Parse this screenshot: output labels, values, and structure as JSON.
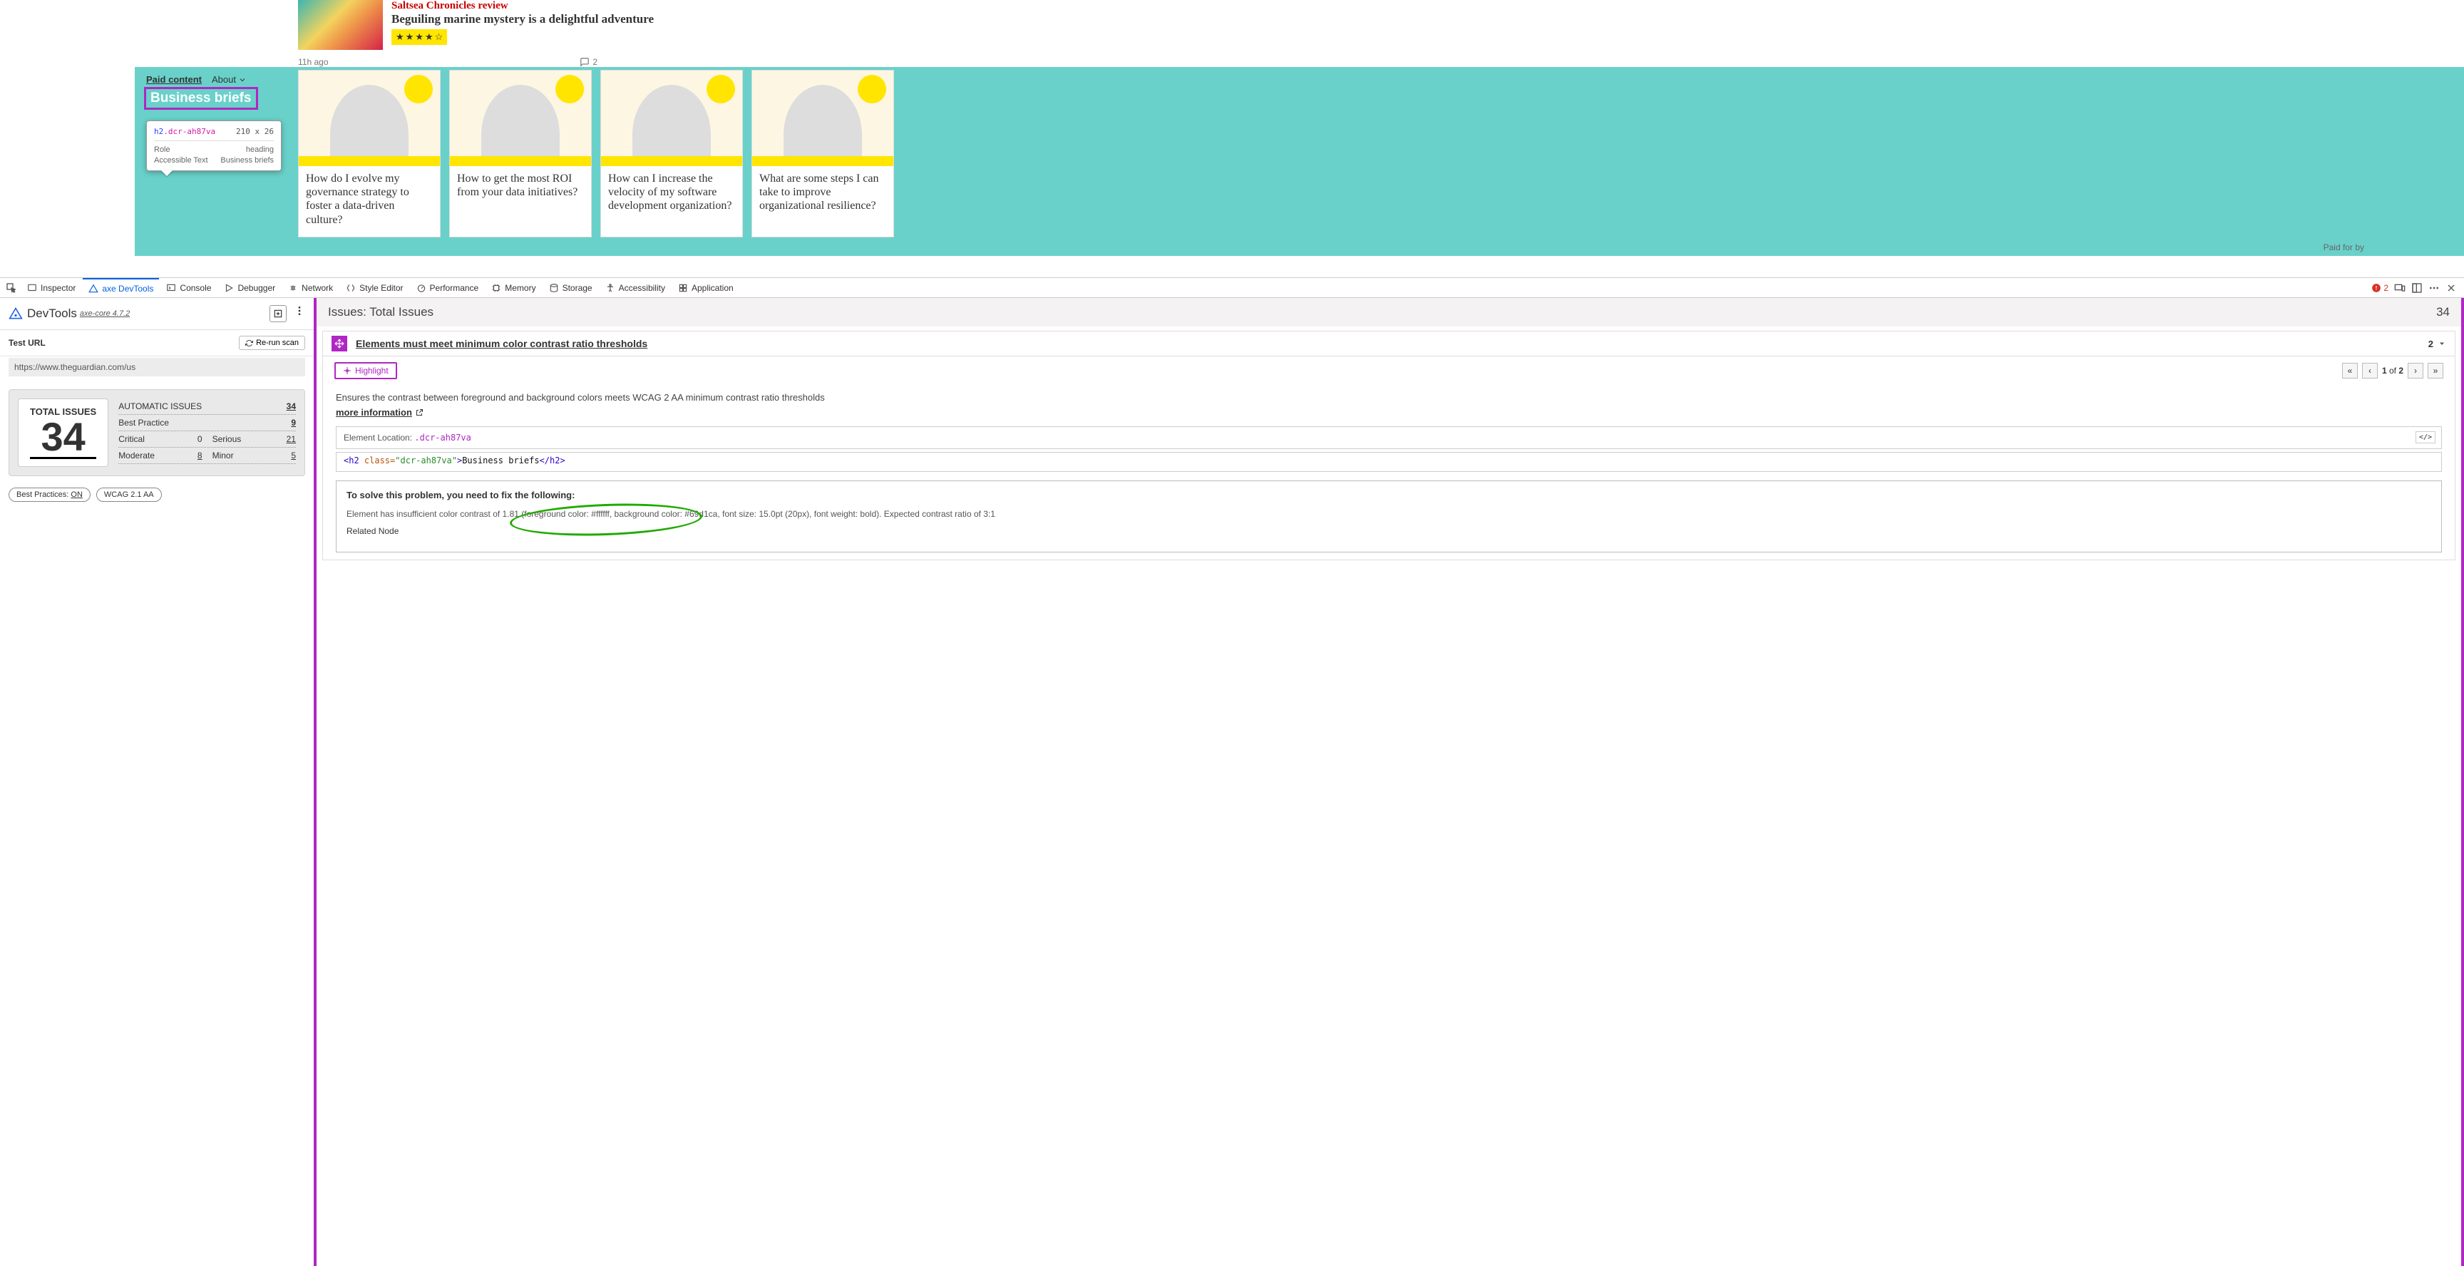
{
  "article": {
    "kicker": "Saltsea Chronicles review",
    "headline": "Beguiling marine mystery is a delightful adventure",
    "time": "11h ago",
    "comments": "2",
    "star_full": "★",
    "star_empty": "☆"
  },
  "paid": {
    "label": "Paid content",
    "about": "About",
    "heading": "Business briefs",
    "paid_for": "Paid for by",
    "cards": [
      {
        "title": "How do I evolve my governance strategy to foster a data-driven culture?"
      },
      {
        "title": "How to get the most ROI from your data initiatives?"
      },
      {
        "title": "How can I increase the velocity of my software development organization?"
      },
      {
        "title": "What are some steps I can take to improve organizational resilience?"
      }
    ]
  },
  "inspect": {
    "tag": "h2",
    "cls": ".dcr-ah87va",
    "dims": "210 x 26",
    "role_label": "Role",
    "role": "heading",
    "acc_label": "Accessible Text",
    "acc": "Business briefs"
  },
  "devtools": {
    "tabs": {
      "inspector": "Inspector",
      "axe": "axe DevTools",
      "console": "Console",
      "debugger": "Debugger",
      "network": "Network",
      "style": "Style Editor",
      "perf": "Performance",
      "memory": "Memory",
      "storage": "Storage",
      "accessibility": "Accessibility",
      "application": "Application"
    },
    "errors": "2"
  },
  "axe": {
    "title": "DevTools",
    "subtitle": "axe-core 4.7.2",
    "test_url_label": "Test URL",
    "rerun": "Re-run scan",
    "url": "https://www.theguardian.com/us",
    "total_label": "TOTAL ISSUES",
    "total": "34",
    "breakdown": {
      "auto_label": "AUTOMATIC ISSUES",
      "auto": "34",
      "bp_label": "Best Practice",
      "bp": "9",
      "critical_label": "Critical",
      "critical": "0",
      "serious_label": "Serious",
      "serious": "21",
      "moderate_label": "Moderate",
      "moderate": "8",
      "minor_label": "Minor",
      "minor": "5"
    },
    "pills": {
      "bp": "Best Practices: ",
      "bp_state": "ON",
      "wcag": "WCAG 2.1 AA"
    }
  },
  "main": {
    "title": "Issues: Total Issues",
    "count": "34",
    "issue": {
      "name": "Elements must meet minimum color contrast ratio thresholds",
      "count": "2",
      "highlight": "Highlight",
      "page": "1",
      "of_label": " of ",
      "total": "2",
      "desc": "Ensures the contrast between foreground and background colors meets WCAG 2 AA minimum contrast ratio thresholds",
      "more": "more information",
      "loc_label": "Element Location: ",
      "loc_sel": ".dcr-ah87va",
      "html_open": "<h2 ",
      "html_attr": "class=",
      "html_val": "\"dcr-ah87va\"",
      "html_close": ">",
      "html_text": "Business briefs",
      "html_end": "</h2>",
      "fix_title": "To solve this problem, you need to fix the following:",
      "fix_detail": "Element has insufficient color contrast of 1.81 (foreground color: #ffffff, background color: #69d1ca, font size: 15.0pt (20px), font weight: bold). Expected contrast ratio of 3:1",
      "related": "Related Node"
    }
  }
}
